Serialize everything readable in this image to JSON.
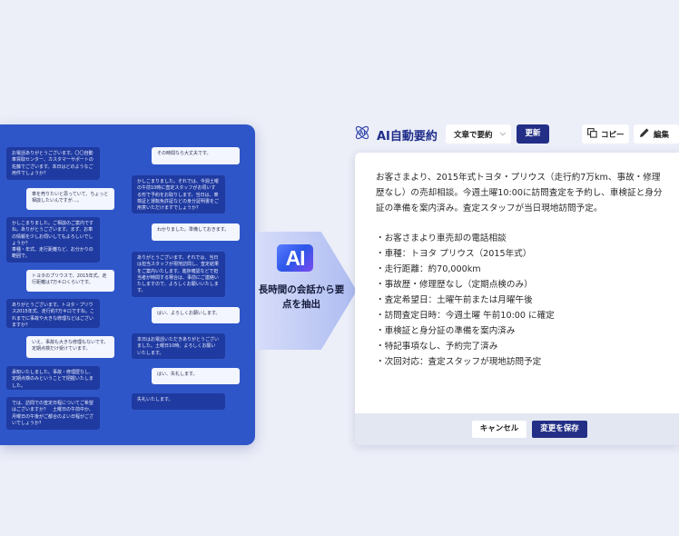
{
  "chat": {
    "messages": [
      {
        "side": "agent",
        "text": "お電話ありがとうございます。〇〇自動車買取センター、カスタマーサポートの佐藤でございます。本日はどのようなご用件でしょうか？"
      },
      {
        "side": "customer",
        "text": "その時間なら大丈夫です。"
      },
      {
        "side": "customer",
        "text": "車を売りたいと思っていて、ちょっと相談したいんですが…。"
      },
      {
        "side": "agent",
        "text": "かしこまりました。それでは、今週土曜の午前10時に査定スタッフがお伺いする形で予約をお取りします。当日は、車検証と運転免許証などの身分証明書をご用意いただけますでしょうか？"
      },
      {
        "side": "agent",
        "text": "かしこまりました。ご相談のご案内ですね。ありがとうございます。まず、お車の情報を少しお伺いしてもよろしいでしょうか？\n車種・年式、走行距離など、お分かりの範囲で。"
      },
      {
        "side": "customer",
        "text": "わかりました。準備しておきます。"
      },
      {
        "side": "customer",
        "text": "トヨタのプリウスで、2015年式。走行距離は7万キロくらいです。"
      },
      {
        "side": "agent",
        "text": "ありがとうございます。それでは、当日は担当スタッフが現地訪問し、査定結果をご案内いたします。進捗確認などで担当者が時間する場合は、事前にご連絡いたしますので、よろしくお願いいたします。"
      },
      {
        "side": "agent",
        "text": "ありがとうございます。トヨタ・プリウス2015年式、走行約7万キロですね。これまでに事故や大きな修理などはございますか？"
      },
      {
        "side": "customer",
        "text": "はい、よろしくお願いします。"
      },
      {
        "side": "customer",
        "text": "いえ、事故も大きな修理もないです。定期点検だけ受けています。"
      },
      {
        "side": "agent",
        "text": "本日はお電話いただきありがとうございました。土曜日10時、よろしくお願いいたします。"
      },
      {
        "side": "agent",
        "text": "承知いたしました。事故・修理歴なし、定期点検のみということで把握いたしました。"
      },
      {
        "side": "customer",
        "text": "はい、失礼します。"
      },
      {
        "side": "agent",
        "text": "では、訪問での査定日程についてご希望はございますか？　土曜日の午前中か、月曜日の午後がご都合のよい日程がございでしょうか？"
      },
      {
        "side": "agent",
        "text": "失礼いたします。"
      }
    ]
  },
  "badge": {
    "logo_text": "AI",
    "caption": "長時間の会話から要点を抽出"
  },
  "summary": {
    "title": "AI自動要約",
    "mode_select": "文章で要約",
    "update_label": "更新",
    "copy_label": "コピー",
    "edit_label": "編集",
    "paragraph": "お客さまより、2015年式トヨタ・プリウス（走行約7万km、事故・修理歴なし）の売却相談。今週土曜10:00に訪問査定を予約し、車検証と身分証の準備を案内済み。査定スタッフが当日現地訪問予定。",
    "bullets": [
      "・お客さまより車売却の電話相談",
      "・車種：トヨタ プリウス（2015年式）",
      "・走行距離：約70,000km",
      "・事故歴・修理歴なし（定期点検のみ）",
      "・査定希望日：土曜午前または月曜午後",
      "・訪問査定日時：今週土曜 午前10:00 に確定",
      "・車検証と身分証の準備を案内済み",
      "・特記事項なし、予約完了済み",
      "・次回対応：査定スタッフが現地訪問予定"
    ],
    "cancel_label": "キャンセル",
    "save_label": "変更を保存"
  },
  "colors": {
    "panel_blue": "#2f56c9",
    "brand_navy": "#232f86",
    "background": "#eceef8"
  }
}
